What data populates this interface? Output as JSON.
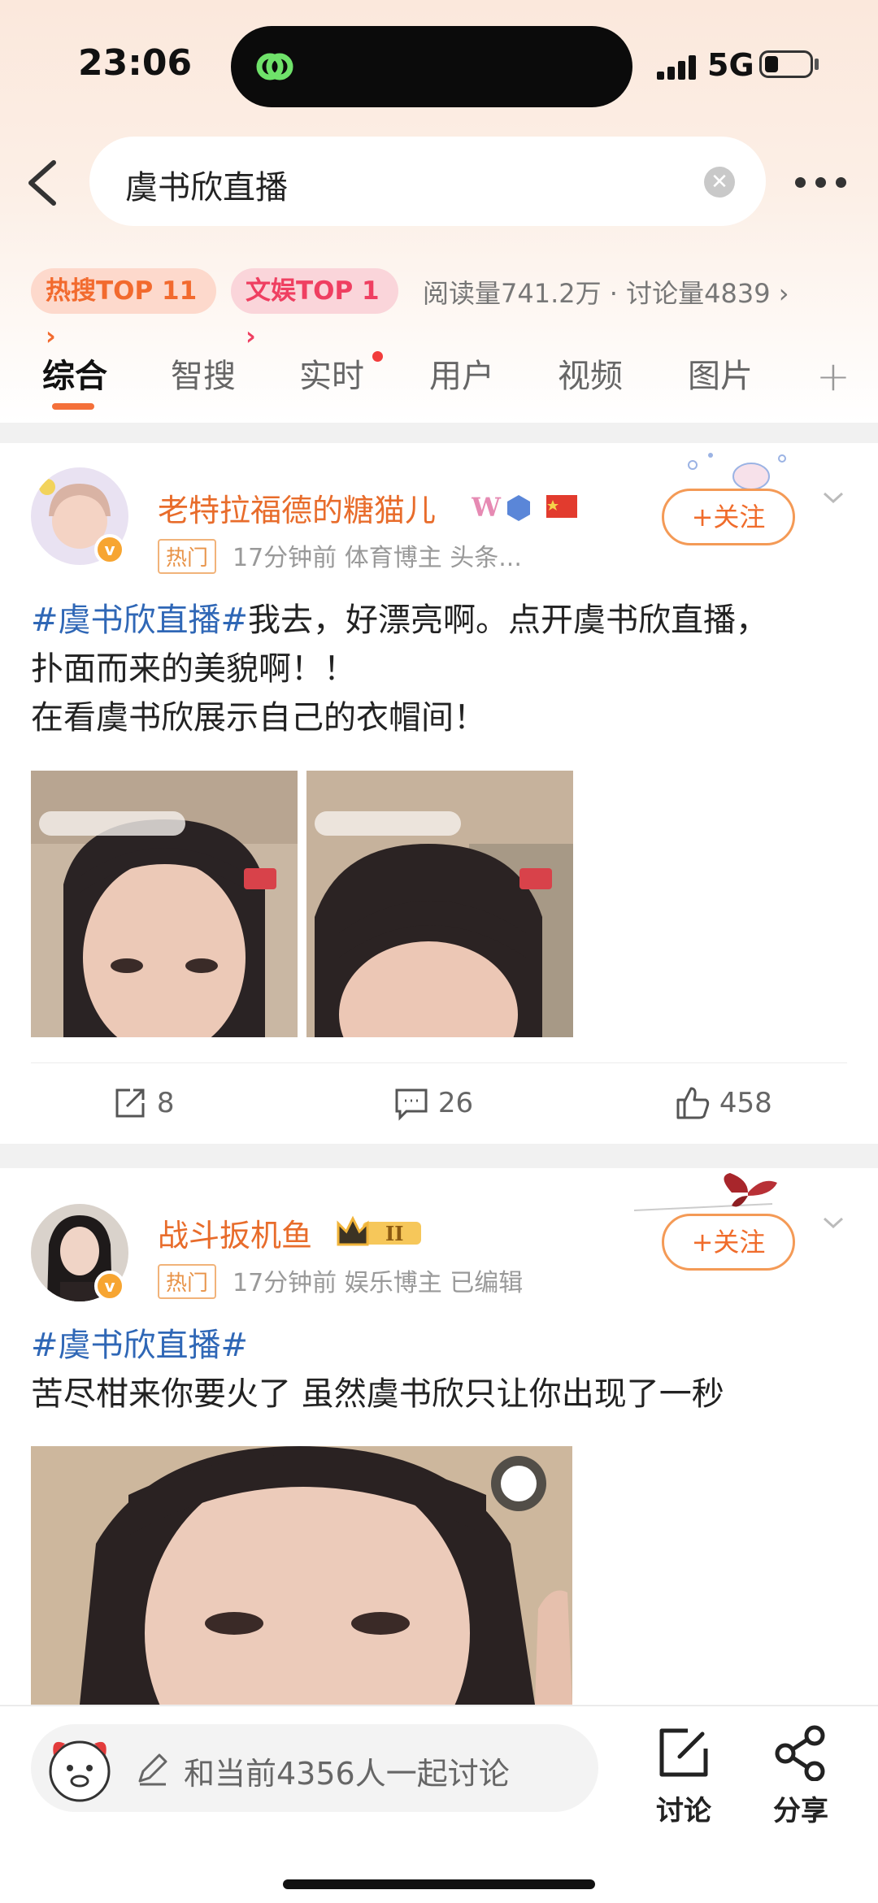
{
  "status": {
    "time": "23:06",
    "network": "5G"
  },
  "search": {
    "query": "虞书欣直播"
  },
  "trends": {
    "hot": "热搜TOP 11 ›",
    "ent": "文娱TOP 1 ›",
    "stats": "阅读量741.2万 · 讨论量4839 ›"
  },
  "tabs": [
    "综合",
    "智搜",
    "实时",
    "用户",
    "视频",
    "图片"
  ],
  "posts": [
    {
      "user": "老特拉福德的糖猫儿",
      "badge": "热门",
      "meta": "17分钟前  体育博主 头条...",
      "follow": "+关注",
      "topic": "#虞书欣直播#",
      "text1": "我去，好漂亮啊。点开虞书欣直播，",
      "text2": "扑面而来的美貌啊！！",
      "text3": "在看虞书欣展示自己的衣帽间！",
      "shares": "8",
      "comments": "26",
      "likes": "458"
    },
    {
      "user": "战斗扳机鱼",
      "badge": "热门",
      "meta": "17分钟前  娱乐博主  已编辑",
      "follow": "+关注",
      "topic": "#虞书欣直播#",
      "text1": "苦尽柑来你要火了 虽然虞书欣只让你出现了一秒"
    }
  ],
  "bottom": {
    "compose": "和当前4356人一起讨论",
    "discuss": "讨论",
    "share": "分享"
  },
  "colors": {
    "accent": "#f06c2b",
    "topic": "#2f67b6",
    "hot": "#f26a2e",
    "ent": "#ef3f61"
  }
}
